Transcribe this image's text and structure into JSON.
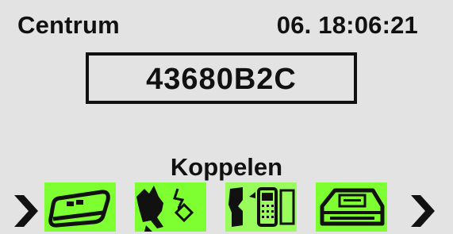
{
  "header": {
    "location": "Centrum",
    "datetime": "06. 18:06:21"
  },
  "display": {
    "id_code": "43680B2C"
  },
  "mode": {
    "label": "Koppelen"
  },
  "icons": [
    {
      "name": "hub-device-icon"
    },
    {
      "name": "pigeon-pair-icon"
    },
    {
      "name": "pigeon-phone-icon"
    },
    {
      "name": "printer-icon"
    }
  ],
  "colors": {
    "background": "#e3e3e3",
    "accent": "#7dff32",
    "text": "#111111"
  }
}
